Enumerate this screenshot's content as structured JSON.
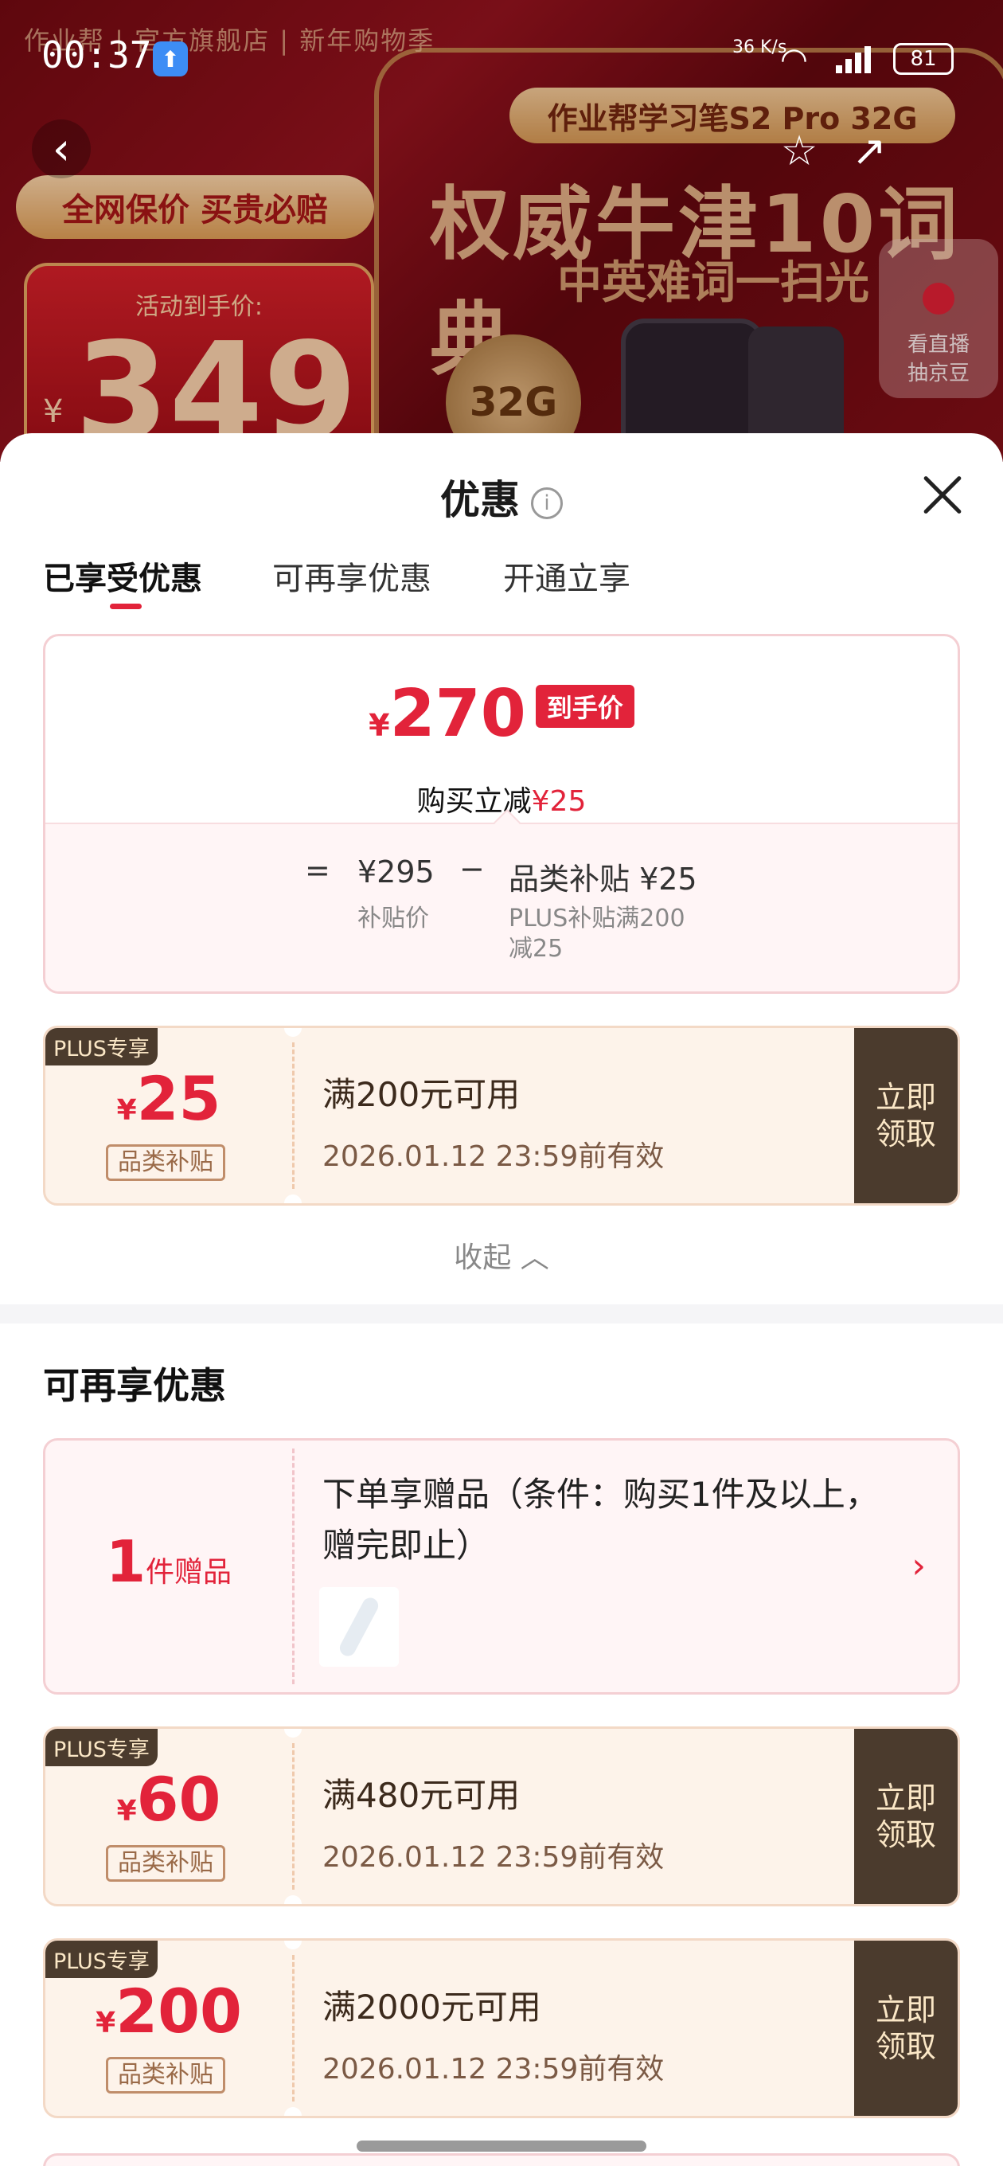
{
  "status_bar": {
    "time": "00:37",
    "net": "36 K/s",
    "battery": "81"
  },
  "banner": {
    "brand": "作业帮 | 官方旗舰店 | 新年购物季",
    "product": "作业帮学习笔S2 Pro 32G",
    "headline": "权威牛津10词典",
    "subline": "中英难词一扫光",
    "promise": "全网保价 买贵必赔",
    "price_caption": "活动到手价:",
    "price_yen": "¥",
    "price": "349",
    "storage": "32G",
    "live": "看直播\n抽京豆"
  },
  "sheet": {
    "title": "优惠",
    "info_icon": "i",
    "tabs": [
      "已享受优惠",
      "可再享优惠",
      "开通立享"
    ],
    "summary": {
      "yen": "¥",
      "final_price": "270",
      "final_tag": "到手价",
      "reduce_prefix": "购买立减",
      "reduce_amount": "¥25",
      "eq": "=",
      "base_price": "¥295",
      "base_label": "补贴价",
      "minus": "−",
      "discount_name": "品类补贴 ¥25",
      "discount_desc": "PLUS补贴满200\n减25"
    },
    "coupons_enjoyed": [
      {
        "badge": "PLUS专享",
        "yen": "¥",
        "amount": "25",
        "category": "品类补贴",
        "condition": "满200元可用",
        "expire": "2026.01.12 23:59前有效",
        "action": "立即\n领取"
      }
    ],
    "collapse_label": "收起",
    "section_more": "可再享优惠",
    "gift": {
      "count": "1",
      "unit": "件赠品",
      "desc": "下单享赠品（条件：购买1件及以上，赠完即止）"
    },
    "coupons_more": [
      {
        "badge": "PLUS专享",
        "yen": "¥",
        "amount": "60",
        "category": "品类补贴",
        "condition": "满480元可用",
        "expire": "2026.01.12 23:59前有效",
        "action": "立即\n领取"
      },
      {
        "badge": "PLUS专享",
        "yen": "¥",
        "amount": "200",
        "category": "品类补贴",
        "condition": "满2000元可用",
        "expire": "2026.01.12 23:59前有效",
        "action": "立即\n领取"
      }
    ]
  },
  "colors": {
    "accent": "#e2233a",
    "coupon_dark": "#4b3b2d",
    "coupon_bg": "#fdf3ea"
  }
}
